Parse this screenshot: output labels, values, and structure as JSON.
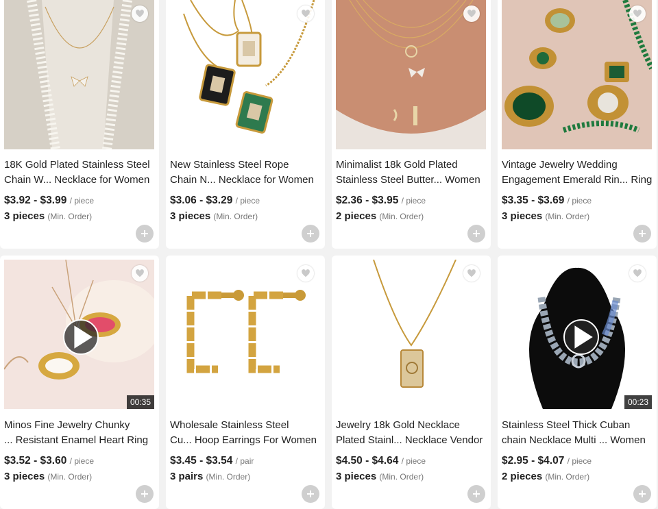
{
  "products": [
    {
      "title_line1": "18K Gold Plated Stainless Steel",
      "title_line2": "Chain W... Necklace for Women",
      "price": "$3.92 - $3.99",
      "unit": "/ piece",
      "moq": "3 pieces",
      "moq_note": "(Min. Order)"
    },
    {
      "title_line1": "New Stainless Steel Rope",
      "title_line2": "Chain N... Necklace for Women",
      "price": "$3.06 - $3.29",
      "unit": "/ piece",
      "moq": "3 pieces",
      "moq_note": "(Min. Order)"
    },
    {
      "title_line1": "Minimalist 18k Gold Plated",
      "title_line2": "Stainless Steel Butter... Women",
      "price": "$2.36 - $3.95",
      "unit": "/ piece",
      "moq": "2 pieces",
      "moq_note": "(Min. Order)"
    },
    {
      "title_line1": "Vintage Jewelry Wedding",
      "title_line2": "Engagement Emerald Rin... Ring",
      "price": "$3.35 - $3.69",
      "unit": "/ piece",
      "moq": "3 pieces",
      "moq_note": "(Min. Order)"
    },
    {
      "title_line1": "Minos Fine Jewelry Chunky",
      "title_line2": "... Resistant Enamel Heart Ring",
      "price": "$3.52 - $3.60",
      "unit": "/ piece",
      "moq": "3 pieces",
      "moq_note": "(Min. Order)",
      "duration": "00:35"
    },
    {
      "title_line1": "Wholesale Stainless Steel",
      "title_line2": "Cu... Hoop Earrings For Women",
      "price": "$3.45 - $3.54",
      "unit": "/ pair",
      "moq": "3 pairs",
      "moq_note": "(Min. Order)"
    },
    {
      "title_line1": "Jewelry 18k Gold Necklace",
      "title_line2": "Plated Stainl... Necklace Vendor",
      "price": "$4.50 - $4.64",
      "unit": "/ piece",
      "moq": "3 pieces",
      "moq_note": "(Min. Order)"
    },
    {
      "title_line1": "Stainless Steel Thick Cuban",
      "title_line2": "chain Necklace Multi ... Women",
      "price": "$2.95 - $4.07",
      "unit": "/ piece",
      "moq": "2 pieces",
      "moq_note": "(Min. Order)",
      "duration": "00:23"
    }
  ],
  "icons": {
    "favorite": "heart-icon",
    "add": "plus-icon",
    "play": "play-icon"
  },
  "colors": {
    "background": "#f2f2f2",
    "card": "#ffffff",
    "text": "#222222",
    "muted": "#777777",
    "add_button": "#cfcfcf"
  }
}
